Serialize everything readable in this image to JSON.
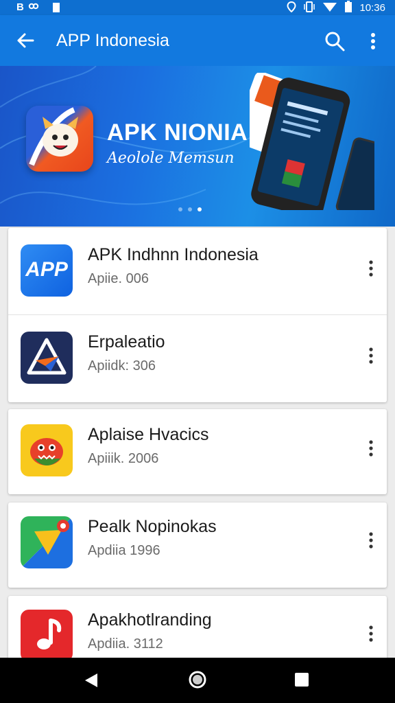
{
  "status_bar": {
    "left_icons": [
      "bluetooth-icon",
      "link-icon",
      "sim-icon"
    ],
    "right_icons": [
      "location-icon",
      "vibrate-icon",
      "wifi-icon",
      "battery-icon"
    ],
    "time": "10:36"
  },
  "app_bar": {
    "title": "APP Indonesia",
    "back_icon": "arrow-left-icon",
    "search_icon": "search-icon",
    "more_icon": "more-vert-icon"
  },
  "banner": {
    "title": "APK NIONIA",
    "subtitle": "Aeolole Memsun",
    "dots_count": 3,
    "active_dot": 2
  },
  "apps": [
    {
      "name": "APK Indhnn Indonesia",
      "sub": "Apiie. 006",
      "icon_text": "APP"
    },
    {
      "name": "Erpaleatio",
      "sub": "Apiidk: 306",
      "icon_text": ""
    },
    {
      "name": "Aplaise Hvacics",
      "sub": "Apiiik. 2006",
      "icon_text": ""
    },
    {
      "name": "Pealk Nopinokas",
      "sub": "Apdiia 1996",
      "icon_text": ""
    },
    {
      "name": "Apakhotlranding",
      "sub": "Apdiia. 3112",
      "icon_text": ""
    }
  ],
  "colors": {
    "app_bar": "#1279df",
    "status_bar": "#0e6fd0",
    "background": "#ececec"
  }
}
